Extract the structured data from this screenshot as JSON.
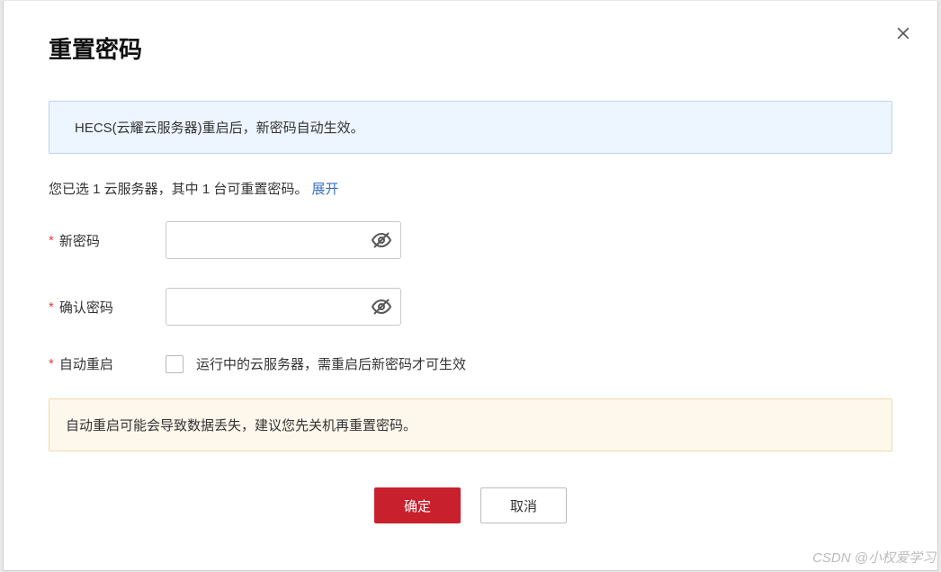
{
  "modal": {
    "title": "重置密码",
    "info_banner": "HECS(云耀云服务器)重启后，新密码自动生效。",
    "selection_prefix": "您已选 1 云服务器，其中 1 台可重置密码。",
    "expand_label": "展开"
  },
  "fields": {
    "new_password_label": "新密码",
    "confirm_password_label": "确认密码",
    "auto_restart_label": "自动重启",
    "auto_restart_hint": "运行中的云服务器，需重启后新密码才可生效",
    "new_password_value": "",
    "confirm_password_value": ""
  },
  "warn_banner": "自动重启可能会导致数据丢失，建议您先关机再重置密码。",
  "actions": {
    "confirm": "确定",
    "cancel": "取消"
  },
  "watermark": "CSDN @小权爱学习"
}
